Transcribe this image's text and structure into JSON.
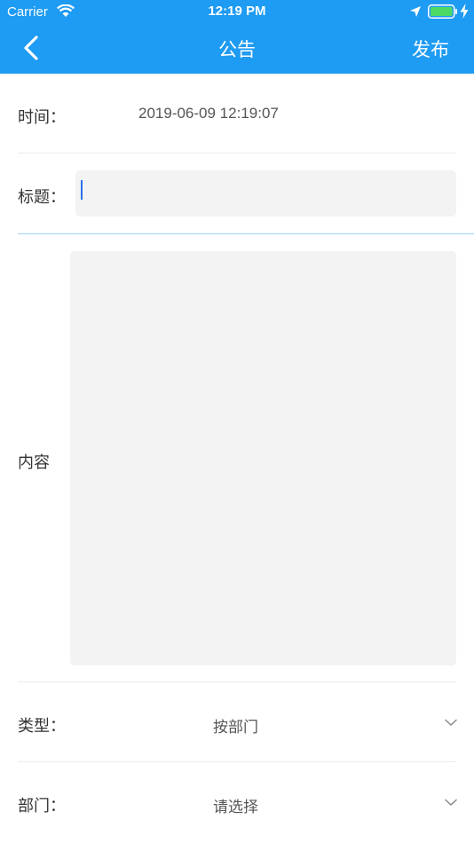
{
  "status_bar": {
    "carrier": "Carrier",
    "time": "12:19 PM"
  },
  "nav": {
    "title": "公告",
    "publish_label": "发布",
    "back_icon": "chevron-left-icon",
    "background_color": "#1e9bf3"
  },
  "form": {
    "time_label": "时间：",
    "time_value": "2019-06-09 12:19:07",
    "title_label": "标题：",
    "title_value": "",
    "content_label": "内容",
    "content_value": "",
    "type_label": "类型：",
    "type_value": "按部门",
    "department_label": "部门：",
    "department_placeholder": "请选择"
  }
}
